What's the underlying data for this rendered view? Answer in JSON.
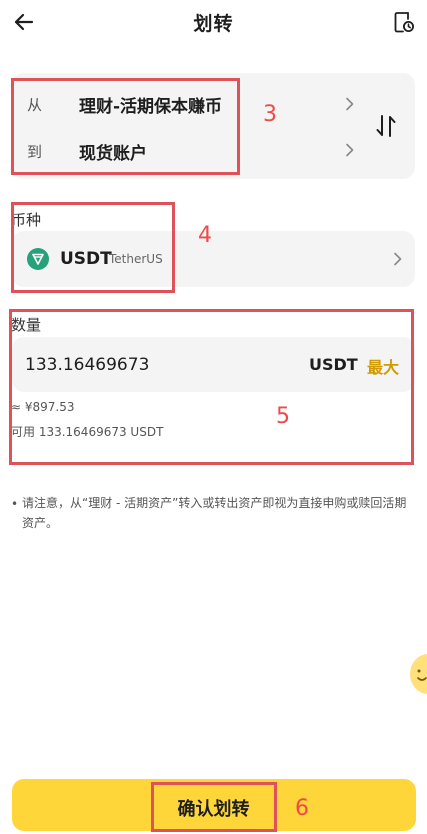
{
  "header": {
    "title": "划转",
    "back_icon": "arrow-left-icon",
    "history_icon": "document-clock-icon"
  },
  "transfer": {
    "from_label": "从",
    "from_value": "理财-活期保本赚币",
    "to_label": "到",
    "to_value": "现货账户",
    "swap_icon": "swap-arrows-icon"
  },
  "currency": {
    "section_label": "币种",
    "symbol": "USDT",
    "name": "TetherUS",
    "logo_color": "#26a17b"
  },
  "amount": {
    "section_label": "数量",
    "value": "133.16469673",
    "unit": "USDT",
    "max_label": "最大",
    "fiat_estimate": "≈ ¥897.53",
    "available": "可用 133.16469673 USDT"
  },
  "notice": {
    "bullet": "•",
    "text": "请注意，从“理财 - 活期资产”转入或转出资产即视为直接申购或赎回活期资产。"
  },
  "confirm": {
    "label": "确认划转"
  },
  "annotations": {
    "a3": "3",
    "a4": "4",
    "a5": "5",
    "a6": "6"
  },
  "colors": {
    "accent": "#ffd63a",
    "max_text": "#d09b00",
    "annotation": "#e0525a"
  }
}
